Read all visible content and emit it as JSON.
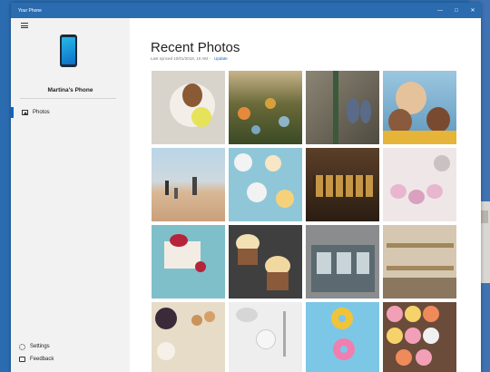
{
  "window": {
    "title": "Your Phone",
    "controls": [
      "minimize",
      "maximize",
      "close"
    ],
    "accent": "#2b6cb0"
  },
  "sidebar": {
    "phone_name": "Martina's Phone",
    "nav": [
      {
        "label": "Photos",
        "icon": "photo-icon",
        "selected": true
      }
    ],
    "footer": [
      {
        "label": "Settings",
        "icon": "gear-icon"
      },
      {
        "label": "Feedback",
        "icon": "feedback-icon"
      }
    ]
  },
  "main": {
    "title": "Recent Photos",
    "sync_text": "Last synced 10/01/2018, 10 AM",
    "sync_sep": "·",
    "update_link": "Update",
    "photos": [
      {
        "subject": "dog with tennis ball",
        "bg": "#d8d4cc"
      },
      {
        "subject": "autumn flowers",
        "bg": "#5a6b3a"
      },
      {
        "subject": "feet on rocks",
        "bg": "#6f6a5c"
      },
      {
        "subject": "family selfie",
        "bg": "#6ba6c9"
      },
      {
        "subject": "beach family",
        "bg": "#d9c2a5"
      },
      {
        "subject": "breakfast table",
        "bg": "#8fc7d8"
      },
      {
        "subject": "bakery sign",
        "bg": "#3a2a1c"
      },
      {
        "subject": "macarons",
        "bg": "#efe7e7"
      },
      {
        "subject": "berry cake",
        "bg": "#7fbfc9"
      },
      {
        "subject": "cupcakes",
        "bg": "#3f3f3f"
      },
      {
        "subject": "shop front",
        "bg": "#8a8c8d"
      },
      {
        "subject": "bakery shelves",
        "bg": "#c9b9a0"
      },
      {
        "subject": "baking ingredients",
        "bg": "#e6dcc8"
      },
      {
        "subject": "kitchen utensils",
        "bg": "#eeeeee"
      },
      {
        "subject": "donuts on blue",
        "bg": "#7cc7e6"
      },
      {
        "subject": "donut assortment",
        "bg": "#6b4b3a"
      }
    ]
  }
}
